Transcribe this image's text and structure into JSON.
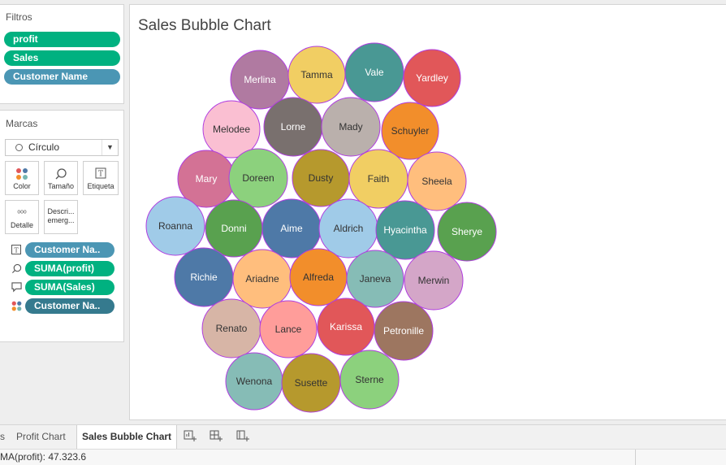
{
  "filters": {
    "title": "Filtros",
    "items": [
      {
        "label": "profit",
        "color": "#00b180"
      },
      {
        "label": "Sales",
        "color": "#00b180"
      },
      {
        "label": "Customer Name",
        "color": "#4b96b4"
      }
    ]
  },
  "marks": {
    "title": "Marcas",
    "mark_type": "Círculo",
    "cards": {
      "color": "Color",
      "size": "Tamaño",
      "label": "Etiqueta",
      "detail": "Detalle",
      "tooltip_line1": "Descri...",
      "tooltip_line2": "emerg..."
    },
    "fields": [
      {
        "icon": "label-icon",
        "label": "Customer Na.."
      },
      {
        "icon": "size-icon",
        "label": "SUMA(profit)"
      },
      {
        "icon": "tooltip-icon",
        "label": "SUMA(Sales)"
      },
      {
        "icon": "color-icon",
        "label": "Customer Na.."
      }
    ]
  },
  "viz": {
    "title": "Sales Bubble Chart"
  },
  "chart_data": {
    "type": "bubble",
    "title": "Sales Bubble Chart",
    "label_field": "Customer Name",
    "size_field": "SUMA(profit)",
    "bubbles": [
      {
        "name": "Merlina",
        "color": "#b07aa1"
      },
      {
        "name": "Tamma",
        "color": "#f1ce63"
      },
      {
        "name": "Vale",
        "color": "#499894"
      },
      {
        "name": "Yardley",
        "color": "#e15759"
      },
      {
        "name": "Melodee",
        "color": "#fabfd2"
      },
      {
        "name": "Lorne",
        "color": "#79706e"
      },
      {
        "name": "Mady",
        "color": "#bab0ac"
      },
      {
        "name": "Schuyler",
        "color": "#f28e2b"
      },
      {
        "name": "Mary",
        "color": "#d37295"
      },
      {
        "name": "Doreen",
        "color": "#8cd17d"
      },
      {
        "name": "Dusty",
        "color": "#b6992d"
      },
      {
        "name": "Faith",
        "color": "#f1ce63"
      },
      {
        "name": "Sheela",
        "color": "#ffbe7d"
      },
      {
        "name": "Roanna",
        "color": "#a0cbe8"
      },
      {
        "name": "Donni",
        "color": "#59a14f"
      },
      {
        "name": "Aime",
        "color": "#4e79a7"
      },
      {
        "name": "Aldrich",
        "color": "#a0cbe8"
      },
      {
        "name": "Hyacintha",
        "color": "#499894"
      },
      {
        "name": "Sherye",
        "color": "#59a14f"
      },
      {
        "name": "Richie",
        "color": "#4e79a7"
      },
      {
        "name": "Ariadne",
        "color": "#ffbe7d"
      },
      {
        "name": "Alfreda",
        "color": "#f28e2b"
      },
      {
        "name": "Janeva",
        "color": "#86bcb6"
      },
      {
        "name": "Merwin",
        "color": "#d4a6c8"
      },
      {
        "name": "Renato",
        "color": "#d7b5a6"
      },
      {
        "name": "Lance",
        "color": "#ff9d9a"
      },
      {
        "name": "Karissa",
        "color": "#e15759"
      },
      {
        "name": "Petronille",
        "color": "#9d7660"
      },
      {
        "name": "Wenona",
        "color": "#86bcb6"
      },
      {
        "name": "Susette",
        "color": "#b6992d"
      },
      {
        "name": "Sterne",
        "color": "#8cd17d"
      }
    ]
  },
  "tabs": {
    "partial": "s",
    "profit_chart": "Profit Chart",
    "bubble_chart": "Sales Bubble Chart"
  },
  "status": {
    "text": "MA(profit): 47.323.6"
  }
}
